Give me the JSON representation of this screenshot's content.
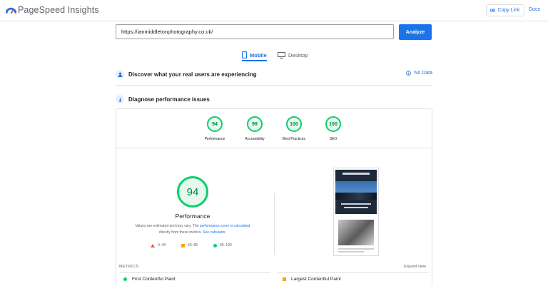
{
  "header": {
    "app_title": "PageSpeed Insights",
    "copy_link_label": "Copy Link",
    "docs_label": "Docs"
  },
  "search": {
    "url_value": "https://ianmiddletonphotography.co.uk/",
    "analyze_label": "Analyze"
  },
  "tabs": [
    {
      "label": "Mobile",
      "icon": "mobile-icon",
      "selected": true
    },
    {
      "label": "Desktop",
      "icon": "desktop-icon",
      "selected": false
    }
  ],
  "real_users": {
    "title": "Discover what your real users are experiencing",
    "status": "No Data"
  },
  "diagnose": {
    "title": "Diagnose performance issues"
  },
  "scores": [
    {
      "label": "Performance",
      "value": "94"
    },
    {
      "label": "Accessibility",
      "value": "99"
    },
    {
      "label": "Best Practices",
      "value": "100"
    },
    {
      "label": "SEO",
      "value": "100"
    }
  ],
  "performance": {
    "score": "94",
    "title": "Performance",
    "note_part1": "Values are estimated and may vary. The ",
    "note_link1": "performance score is calculated",
    "note_part2": "directly from these metrics. ",
    "note_link2": "See calculator."
  },
  "legend": [
    {
      "range": "0–49",
      "shape": "triangle",
      "color": "#ff4e42"
    },
    {
      "range": "50–89",
      "shape": "square",
      "color": "#ffa400"
    },
    {
      "range": "90–100",
      "shape": "circle",
      "color": "#0cce6b"
    }
  ],
  "metrics": {
    "section_label": "METRICS",
    "expand_label": "Expand view",
    "items": [
      {
        "name": "First Contentful Paint",
        "status": "good"
      },
      {
        "name": "Largest Contentful Paint",
        "status": "average"
      }
    ]
  },
  "colors": {
    "accent": "#1a73e8",
    "good": "#0cce6b",
    "good_text": "#018642",
    "average": "#ffa400",
    "poor": "#ff4e42"
  }
}
